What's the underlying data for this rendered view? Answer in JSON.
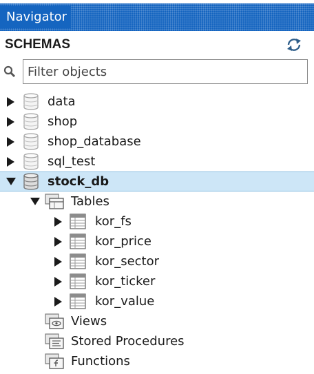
{
  "panel": {
    "title": "Navigator"
  },
  "schemas": {
    "title": "SCHEMAS",
    "refresh_icon": "refresh-icon",
    "filter": {
      "placeholder": "Filter objects",
      "value": "",
      "icon": "search-icon"
    }
  },
  "tree": {
    "schemas": [
      {
        "name": "data",
        "expanded": false
      },
      {
        "name": "shop",
        "expanded": false
      },
      {
        "name": "shop_database",
        "expanded": false
      },
      {
        "name": "sql_test",
        "expanded": false
      },
      {
        "name": "stock_db",
        "expanded": true,
        "selected": true
      }
    ],
    "groups": {
      "tables": "Tables",
      "views": "Views",
      "procedures": "Stored Procedures",
      "functions": "Functions"
    },
    "tables": [
      "kor_fs",
      "kor_price",
      "kor_sector",
      "kor_ticker",
      "kor_value"
    ]
  },
  "colors": {
    "titlebar": "#1565c0",
    "selection": "#cde6f7",
    "selection_border": "#88bde0"
  }
}
